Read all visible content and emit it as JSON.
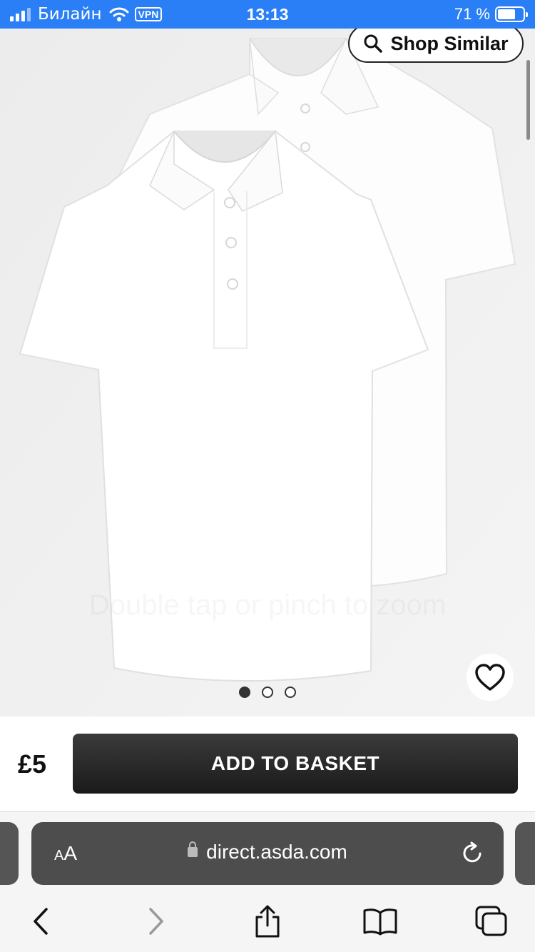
{
  "status_bar": {
    "carrier": "Билайн",
    "vpn": "VPN",
    "time": "13:13",
    "battery": "71 %",
    "battery_level": 0.71
  },
  "gallery": {
    "shop_similar_label": "Shop Similar",
    "zoom_hint": "Double tap or pinch to zoom",
    "image_count": 3,
    "active_image": 1
  },
  "purchase": {
    "price": "£5",
    "add_to_basket": "ADD TO BASKET"
  },
  "safari": {
    "text_size_button": "AA",
    "url": "direct.asda.com"
  },
  "icons": [
    "search-icon",
    "heart-icon",
    "lock-icon",
    "reload-icon",
    "back-icon",
    "forward-icon",
    "share-icon",
    "bookmarks-icon",
    "tabs-icon"
  ],
  "colors": {
    "status_bar": "#2a7ff6",
    "button": "#222222",
    "url_bar": "#4d4d4d"
  }
}
